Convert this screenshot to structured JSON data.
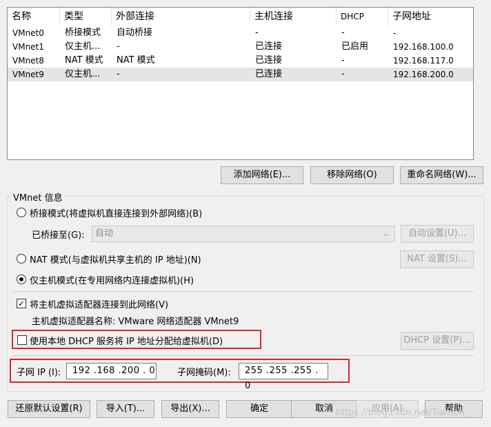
{
  "table": {
    "columns": [
      "名称",
      "类型",
      "外部连接",
      "主机连接",
      "DHCP",
      "子网地址"
    ],
    "rows": [
      {
        "name": "VMnet0",
        "type": "桥接模式",
        "external": "自动桥接",
        "host": "-",
        "dhcp": "-",
        "subnet": "-"
      },
      {
        "name": "VMnet1",
        "type": "仅主机...",
        "external": "-",
        "host": "已连接",
        "dhcp": "已启用",
        "subnet": "192.168.100.0"
      },
      {
        "name": "VMnet8",
        "type": "NAT 模式",
        "external": "NAT 模式",
        "host": "已连接",
        "dhcp": "-",
        "subnet": "192.168.117.0"
      },
      {
        "name": "VMnet9",
        "type": "仅主机...",
        "external": "-",
        "host": "已连接",
        "dhcp": "-",
        "subnet": "192.168.200.0"
      }
    ]
  },
  "list_buttons": {
    "add": "添加网络(E)...",
    "remove": "移除网络(O)",
    "rename": "重命名网络(W)..."
  },
  "vmnet_info": {
    "title": "VMnet 信息",
    "bridged_label": "桥接模式(将虚拟机直接连接到外部网络)(B)",
    "bridged_to_label": "已桥接至(G):",
    "bridged_to_value": "自动",
    "auto_settings": "自动设置(U)...",
    "nat_label": "NAT 模式(与虚拟机共享主机的 IP 地址)(N)",
    "nat_settings": "NAT 设置(S)...",
    "hostonly_label": "仅主机模式(在专用网络内连接虚拟机)(H)",
    "connect_adapter_label": "将主机虚拟适配器连接到此网络(V)",
    "adapter_name": "主机虚拟适配器名称: VMware 网络适配器 VMnet9",
    "use_dhcp_label": "使用本地 DHCP 服务将 IP 地址分配给虚拟机(D)",
    "dhcp_settings": "DHCP 设置(P)...",
    "subnet_ip_label": "子网 IP (I):",
    "subnet_ip_value": "192 .168 .200 .  0",
    "subnet_mask_label": "子网掩码(M):",
    "subnet_mask_value": "255 .255 .255 .  0",
    "selected_mode": "hostonly",
    "connect_adapter_checked": true,
    "use_dhcp_checked": false
  },
  "footer": {
    "restore": "还原默认设置(R)",
    "import": "导入(T)...",
    "export": "导出(X)...",
    "ok": "确定",
    "cancel": "取消",
    "apply": "应用(A)",
    "help": "帮助"
  },
  "watermark": "https://blog.csdn.net/Tiamon_",
  "colors": {
    "highlight_box": "#d9252a",
    "selected_row": "#e5e5e5"
  }
}
